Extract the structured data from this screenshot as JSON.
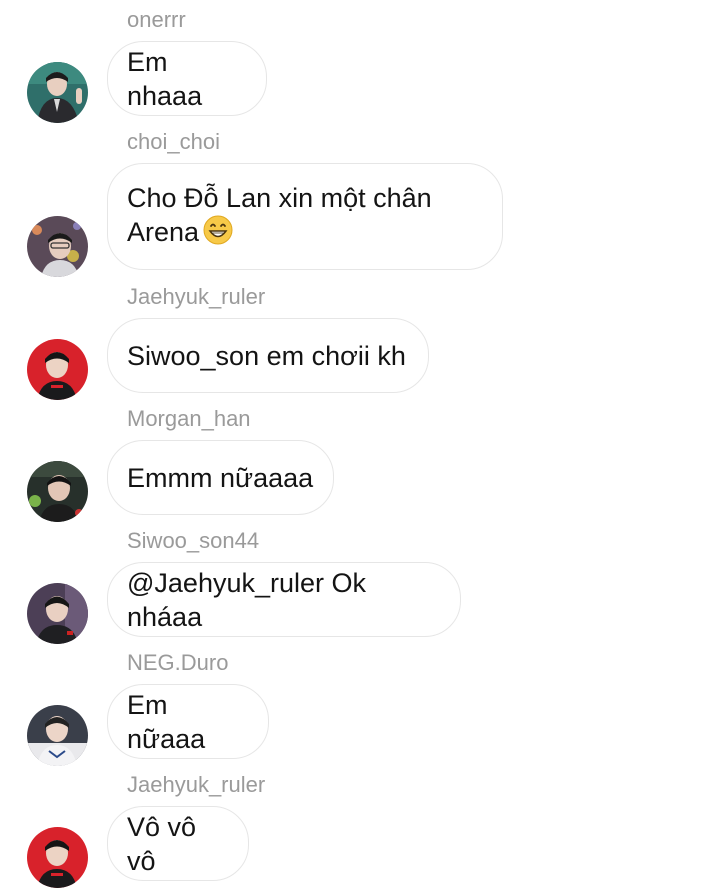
{
  "messages": [
    {
      "sender": "onerrr",
      "text": "Em nhaaa",
      "avatar": "avatar-onerrr"
    },
    {
      "sender": "choi_choi",
      "text_line1": "Cho Đỗ Lan xin một chân",
      "text_line2": "Arena",
      "emoji": "grinning-face-emoji",
      "avatar": "avatar-choi-choi"
    },
    {
      "sender": "Jaehyuk_ruler",
      "text": "Siwoo_son em chơii kh",
      "avatar": "avatar-jaehyuk-ruler"
    },
    {
      "sender": "Morgan_han",
      "text": "Emmm nữaaaa",
      "avatar": "avatar-morgan-han"
    },
    {
      "sender": "Siwoo_son44",
      "text": "@Jaehyuk_ruler Ok nháaa",
      "avatar": "avatar-siwoo-son44"
    },
    {
      "sender": "NEG.Duro",
      "text": "Em nữaaa",
      "avatar": "avatar-neg-duro"
    },
    {
      "sender": "Jaehyuk_ruler",
      "text": "Vô vô vô",
      "avatar": "avatar-jaehyuk-ruler"
    }
  ],
  "colors": {
    "sender_text": "#9a9a9a",
    "message_text": "#141414",
    "bubble_border": "#e6e6e6",
    "background": "#ffffff"
  }
}
